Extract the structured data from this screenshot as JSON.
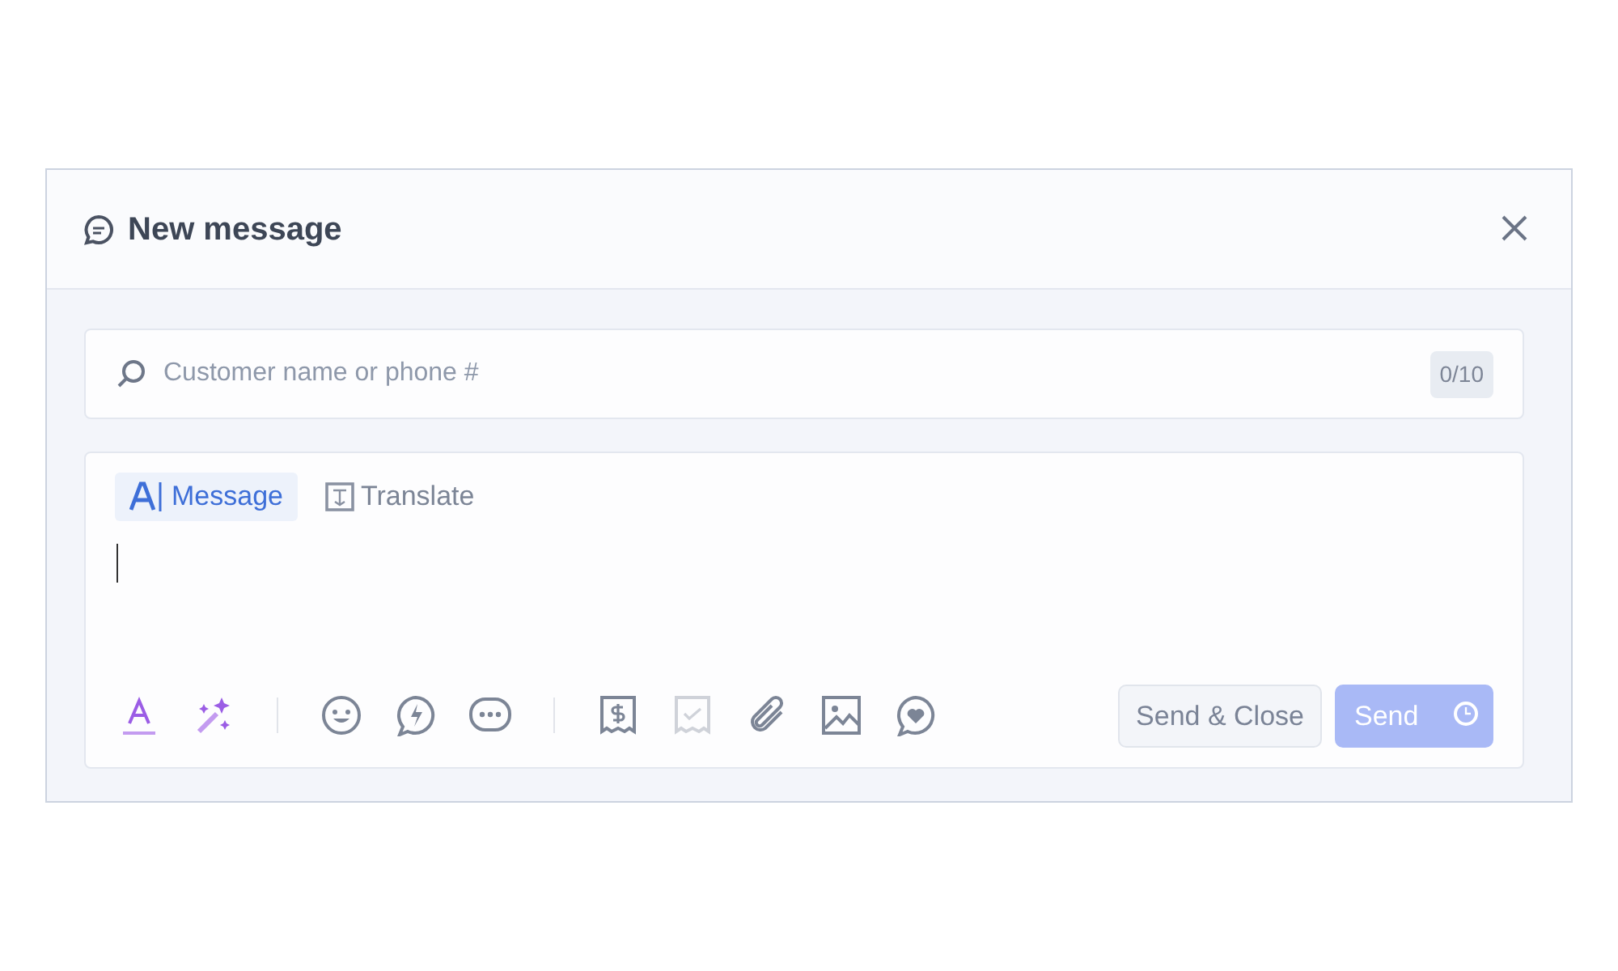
{
  "window": {
    "title": "New message"
  },
  "recipient": {
    "placeholder": "Customer name or phone #",
    "counter": "0/10"
  },
  "tabs": [
    {
      "label": "Message",
      "selected": true,
      "kind": "message"
    },
    {
      "label": "Translate",
      "selected": false,
      "kind": "translate"
    }
  ],
  "toolbar_groups": [
    {
      "items": [
        {
          "kind": "text-color",
          "disabled": false
        },
        {
          "kind": "magic",
          "disabled": false
        }
      ]
    },
    {
      "items": [
        {
          "kind": "emoji",
          "disabled": false
        },
        {
          "kind": "bolt",
          "disabled": false
        },
        {
          "kind": "dots",
          "disabled": false
        }
      ]
    },
    {
      "items": [
        {
          "kind": "payment",
          "disabled": false
        },
        {
          "kind": "check",
          "disabled": true
        },
        {
          "kind": "attach",
          "disabled": false
        },
        {
          "kind": "image",
          "disabled": false
        },
        {
          "kind": "heart",
          "disabled": false
        }
      ]
    }
  ],
  "buttons": [
    {
      "label": "Send & Close",
      "kind": "secondary",
      "disabled": false
    },
    {
      "label": "Send",
      "kind": "primary",
      "disabled": true
    }
  ]
}
